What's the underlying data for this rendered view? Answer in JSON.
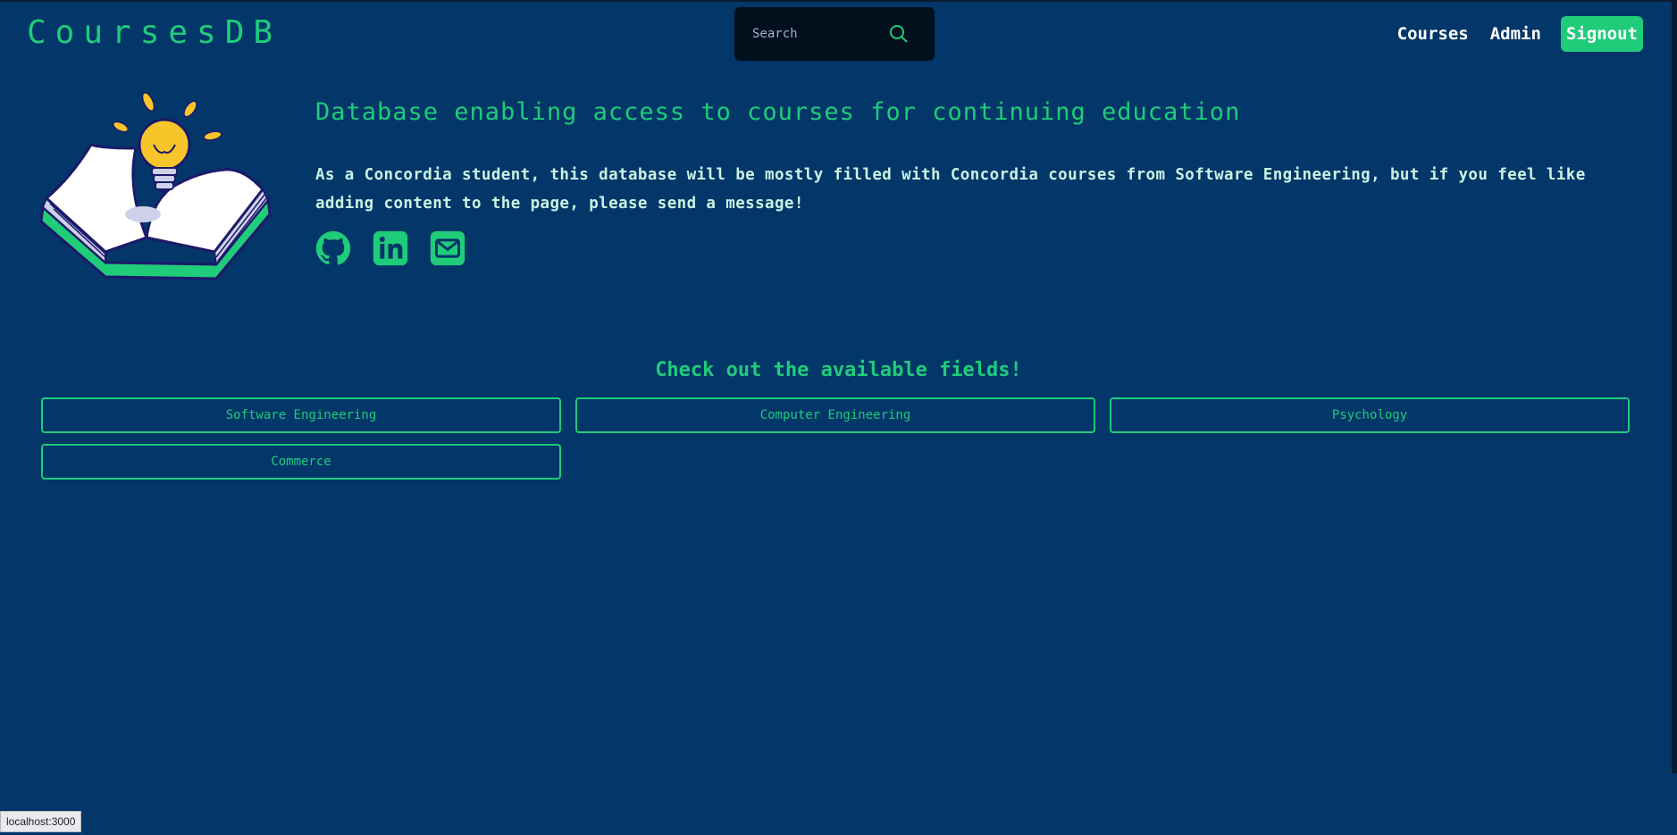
{
  "header": {
    "brand": "CoursesDB",
    "search_placeholder": "Search",
    "nav": {
      "courses": "Courses",
      "admin": "Admin",
      "signout": "Signout"
    }
  },
  "hero": {
    "title": "Database enabling access to courses for continuing education",
    "description": "As a Concordia student, this database will be mostly filled with Concordia courses from Software Engineering, but if you feel like adding content to the page, please send a message!",
    "socials": [
      "github-icon",
      "linkedin-icon",
      "mail-icon"
    ]
  },
  "fields": {
    "heading": "Check out the available fields!",
    "items": [
      "Software Engineering",
      "Computer Engineering",
      "Psychology",
      "Commerce"
    ]
  },
  "status_bar": {
    "url": "localhost:3000"
  },
  "colors": {
    "background": "#033669",
    "accent": "#1fcc7a",
    "search_bg": "#020f1d"
  }
}
